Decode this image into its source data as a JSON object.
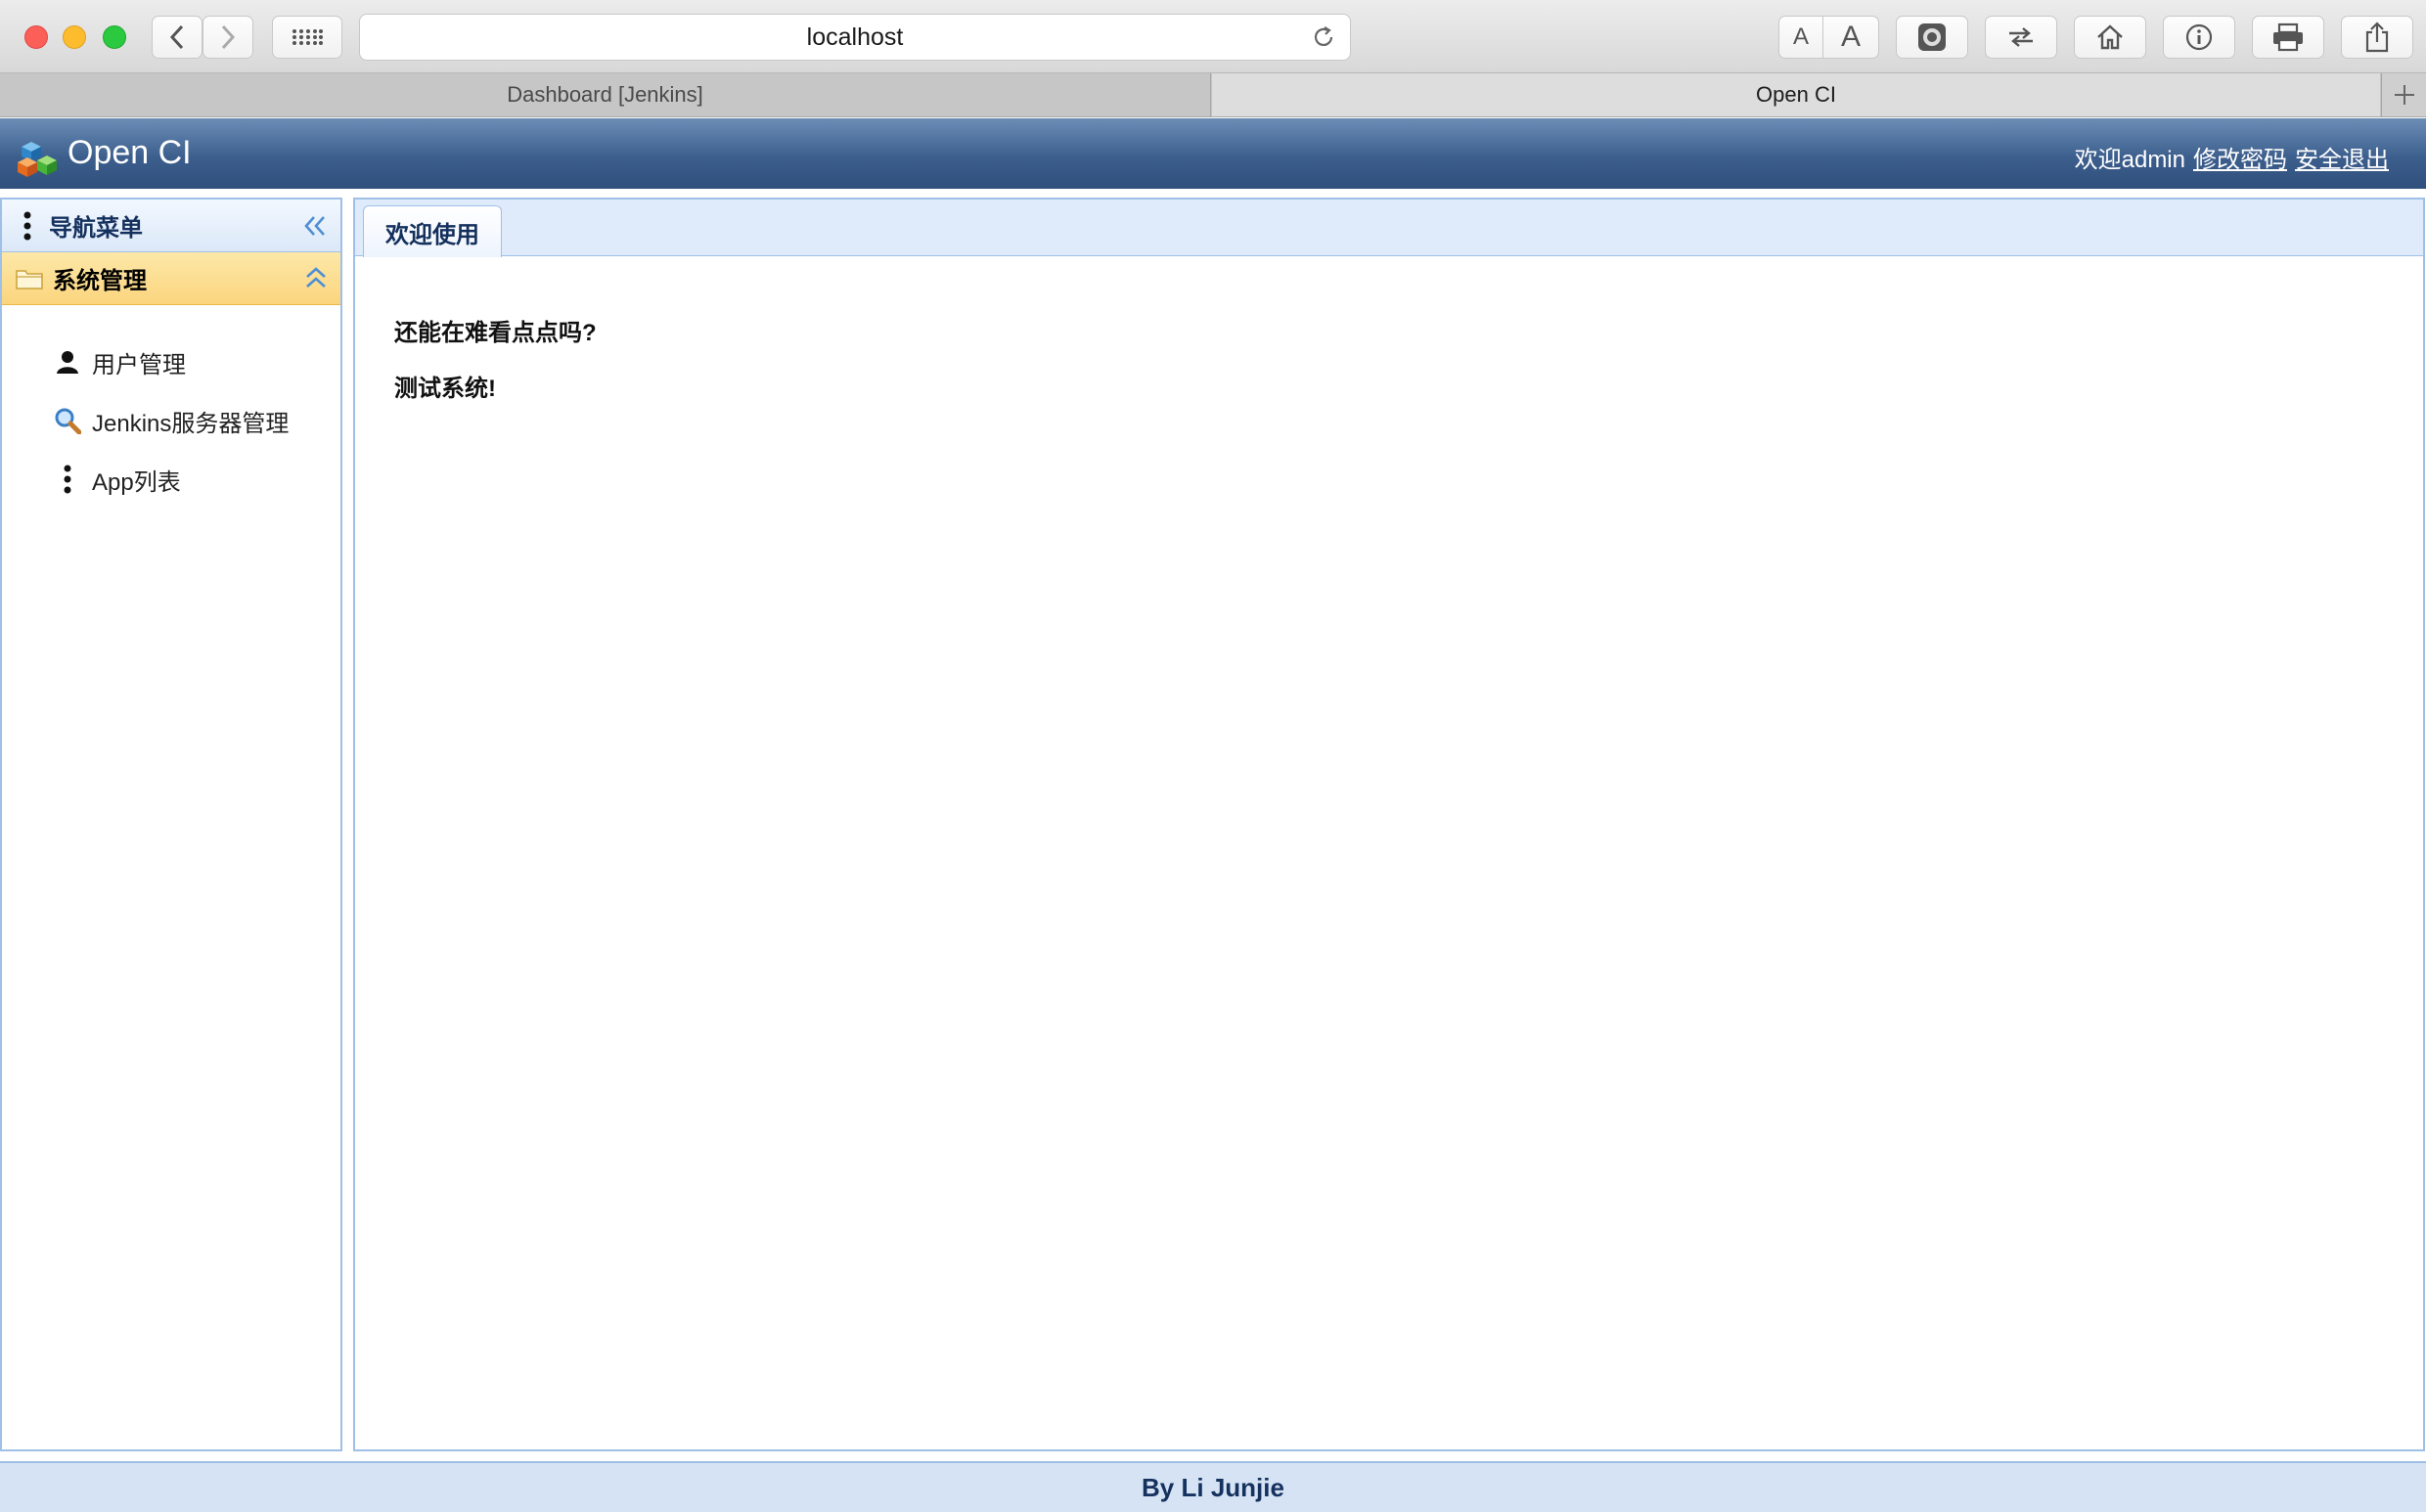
{
  "browser": {
    "url": "localhost",
    "tabs": [
      {
        "label": "Dashboard [Jenkins]"
      },
      {
        "label": "Open CI"
      }
    ]
  },
  "app": {
    "title": "Open CI",
    "welcome": "欢迎admin",
    "change_password": "修改密码",
    "logout": "安全退出"
  },
  "sidebar": {
    "title": "导航菜单",
    "group": "系统管理",
    "items": [
      {
        "label": "用户管理",
        "icon": "user-icon"
      },
      {
        "label": "Jenkins服务器管理",
        "icon": "magnifier-icon"
      },
      {
        "label": "App列表",
        "icon": "vertical-dots-icon"
      }
    ]
  },
  "main": {
    "tab_label": "欢迎使用",
    "lines": [
      "还能在难看点点吗?",
      "测试系统!"
    ]
  },
  "footer": {
    "text": "By Li Junjie"
  },
  "colors": {
    "header_top": "#6b8db6",
    "header_bottom": "#2f4f7c",
    "border": "#9fc0e6",
    "group_highlight": "#fbd57e"
  }
}
